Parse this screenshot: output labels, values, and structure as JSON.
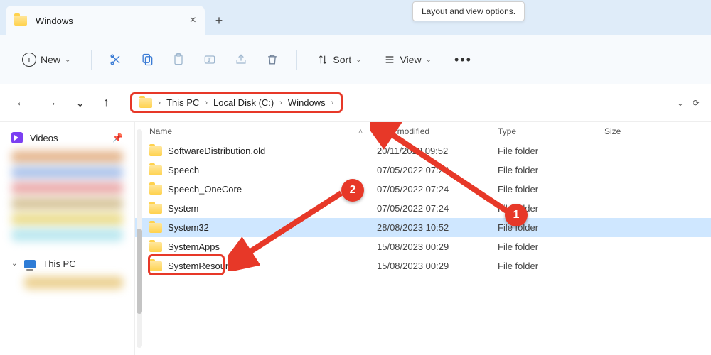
{
  "tab": {
    "title": "Windows"
  },
  "tooltip": "Layout and view options.",
  "toolbar": {
    "new_label": "New",
    "sort_label": "Sort",
    "view_label": "View"
  },
  "breadcrumb": {
    "items": [
      "This PC",
      "Local Disk (C:)",
      "Windows"
    ]
  },
  "sidebar": {
    "videos": "Videos",
    "thispc": "This PC"
  },
  "columns": {
    "name": "Name",
    "date": "Date modified",
    "type": "Type",
    "size": "Size"
  },
  "rows": [
    {
      "name": "SoftwareDistribution.old",
      "date": "20/11/2022 09:52",
      "type": "File folder",
      "selected": false
    },
    {
      "name": "Speech",
      "date": "07/05/2022 07:24",
      "type": "File folder",
      "selected": false
    },
    {
      "name": "Speech_OneCore",
      "date": "07/05/2022 07:24",
      "type": "File folder",
      "selected": false
    },
    {
      "name": "System",
      "date": "07/05/2022 07:24",
      "type": "File folder",
      "selected": false
    },
    {
      "name": "System32",
      "date": "28/08/2023 10:52",
      "type": "File folder",
      "selected": true
    },
    {
      "name": "SystemApps",
      "date": "15/08/2023 00:29",
      "type": "File folder",
      "selected": false
    },
    {
      "name": "SystemResources",
      "date": "15/08/2023 00:29",
      "type": "File folder",
      "selected": false
    }
  ],
  "markers": {
    "one": "1",
    "two": "2"
  }
}
